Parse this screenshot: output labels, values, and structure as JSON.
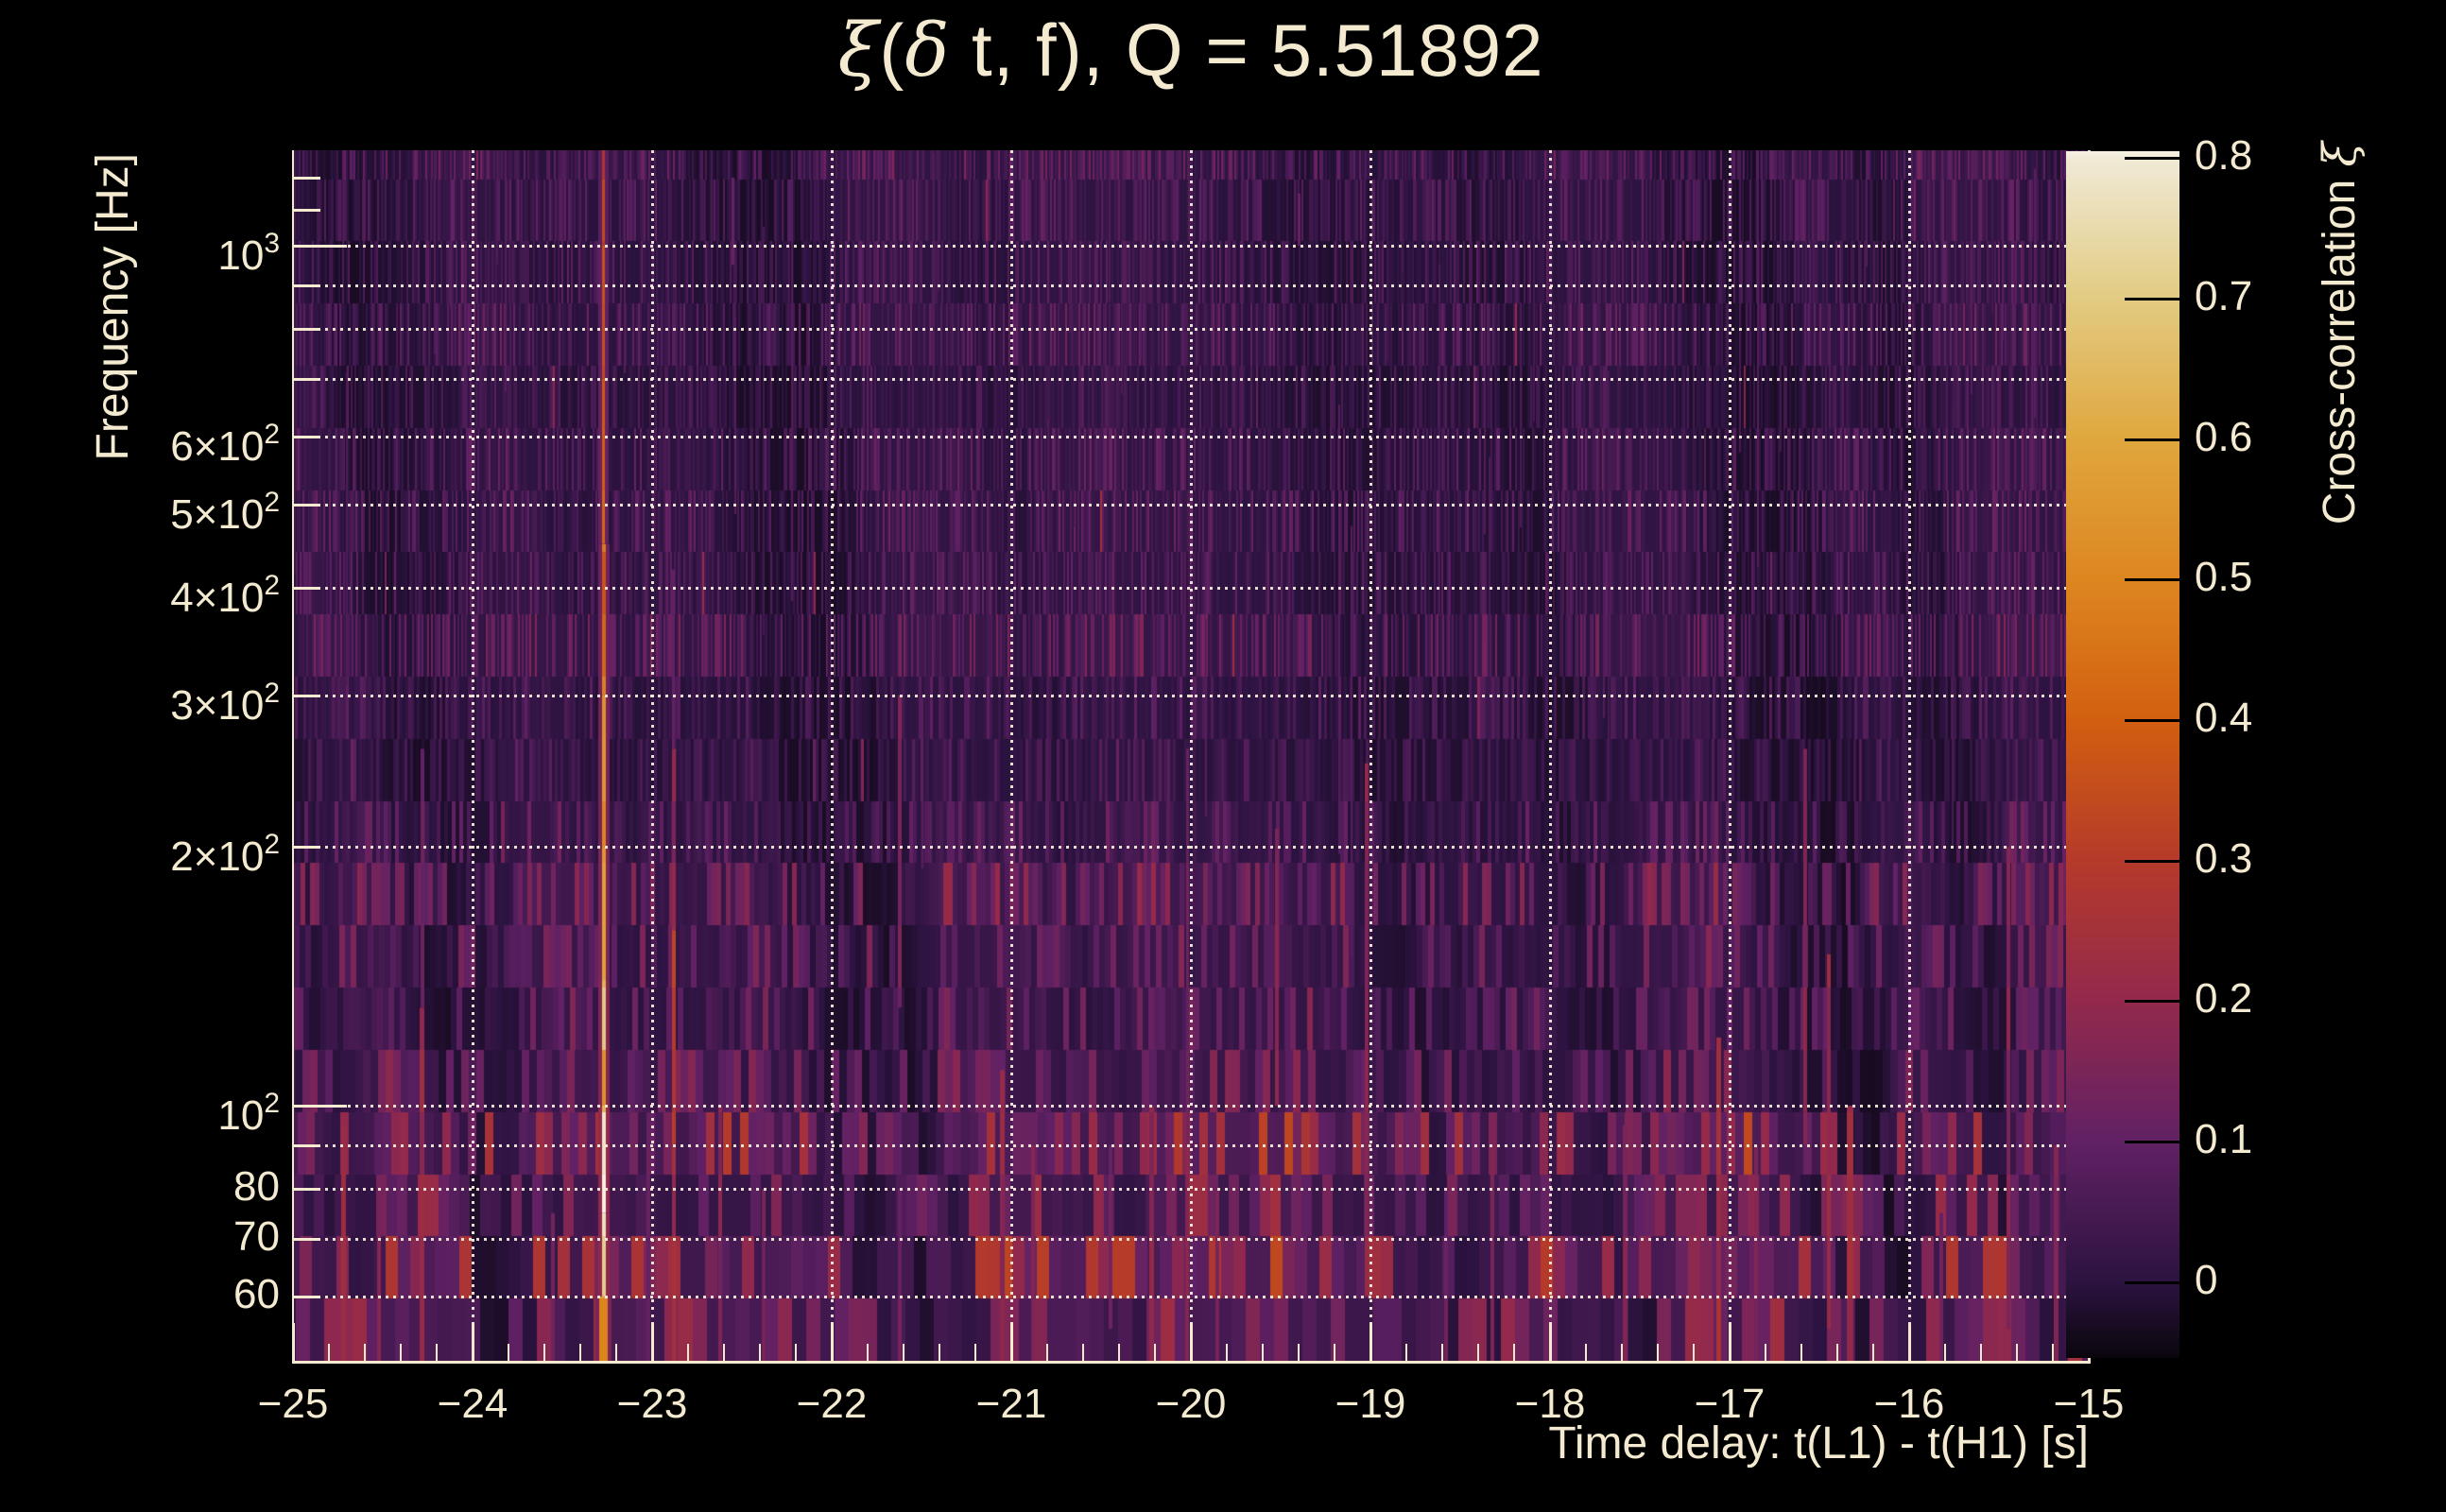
{
  "title": {
    "symbol_xi": "ξ",
    "open_paren": "(",
    "symbol_delta": "δ",
    "rest": " t, f), Q = 5.51892"
  },
  "axes": {
    "x": {
      "label": "Time delay: t(L1) - t(H1) [s]",
      "min": -25,
      "max": -15,
      "major_ticks": [
        {
          "value": -25,
          "label": "−25"
        },
        {
          "value": -24,
          "label": "−24"
        },
        {
          "value": -23,
          "label": "−23"
        },
        {
          "value": -22,
          "label": "−22"
        },
        {
          "value": -21,
          "label": "−21"
        },
        {
          "value": -20,
          "label": "−20"
        },
        {
          "value": -19,
          "label": "−19"
        },
        {
          "value": -18,
          "label": "−18"
        },
        {
          "value": -17,
          "label": "−17"
        },
        {
          "value": -16,
          "label": "−16"
        },
        {
          "value": -15,
          "label": "−15"
        }
      ],
      "minor_tick_step": 0.2
    },
    "y": {
      "label": "Frequency [Hz]",
      "scale": "log",
      "min_hz": 50.5,
      "max_hz": 1295,
      "tick_labels": [
        {
          "hz": 1000,
          "mantissa": "10",
          "exponent": "3"
        },
        {
          "hz": 600,
          "mantissa": "6×10",
          "exponent": "2"
        },
        {
          "hz": 500,
          "mantissa": "5×10",
          "exponent": "2"
        },
        {
          "hz": 400,
          "mantissa": "4×10",
          "exponent": "2"
        },
        {
          "hz": 300,
          "mantissa": "3×10",
          "exponent": "2"
        },
        {
          "hz": 200,
          "mantissa": "2×10",
          "exponent": "2"
        },
        {
          "hz": 100,
          "mantissa": "10",
          "exponent": "2"
        },
        {
          "hz": 80,
          "mantissa": "80",
          "exponent": ""
        },
        {
          "hz": 70,
          "mantissa": "70",
          "exponent": ""
        },
        {
          "hz": 60,
          "mantissa": "60",
          "exponent": ""
        }
      ],
      "gridline_hz": [
        60,
        70,
        80,
        90,
        100,
        200,
        300,
        400,
        500,
        600,
        700,
        800,
        900,
        1000
      ],
      "major_tick_hz": [
        100,
        1000
      ],
      "minor_tick_hz": [
        60,
        70,
        80,
        90,
        200,
        300,
        400,
        500,
        600,
        700,
        800,
        900,
        1100,
        1200
      ]
    }
  },
  "colorbar": {
    "label": "Cross-correlation ",
    "label_symbol": "ξ",
    "min": -0.054,
    "max": 0.805,
    "ticks": [
      {
        "value": 0.8,
        "label": "0.8"
      },
      {
        "value": 0.7,
        "label": "0.7"
      },
      {
        "value": 0.6,
        "label": "0.6"
      },
      {
        "value": 0.5,
        "label": "0.5"
      },
      {
        "value": 0.4,
        "label": "0.4"
      },
      {
        "value": 0.3,
        "label": "0.3"
      },
      {
        "value": 0.2,
        "label": "0.2"
      },
      {
        "value": 0.1,
        "label": "0.1"
      },
      {
        "value": 0.0,
        "label": "0"
      }
    ],
    "stops": [
      {
        "value": -0.054,
        "color": "#0a060c"
      },
      {
        "value": 0.0,
        "color": "#2c1340"
      },
      {
        "value": 0.1,
        "color": "#612164"
      },
      {
        "value": 0.2,
        "color": "#93294c"
      },
      {
        "value": 0.3,
        "color": "#b53a2a"
      },
      {
        "value": 0.4,
        "color": "#d25f10"
      },
      {
        "value": 0.5,
        "color": "#dd8620"
      },
      {
        "value": 0.6,
        "color": "#e0a73e"
      },
      {
        "value": 0.7,
        "color": "#e2cb82"
      },
      {
        "value": 0.8,
        "color": "#f0ead6"
      },
      {
        "value": 0.805,
        "color": "#f6f2e4"
      }
    ]
  },
  "chart_data": {
    "type": "heatmap",
    "title": "ξ(δ t, f), Q = 5.51892",
    "q_value": 5.51892,
    "xlabel": "Time delay: t(L1) - t(H1) [s]",
    "ylabel": "Frequency [Hz]",
    "xlim": [
      -25,
      -15
    ],
    "ylim_hz": [
      50.5,
      1295
    ],
    "y_scale": "log",
    "colorbar_label": "Cross-correlation ξ",
    "colorbar_range": [
      -0.054,
      0.805
    ],
    "grid": true,
    "legend_position": "right-colorbar",
    "background": {
      "mean_xi": 0.02,
      "description": "dark purple Q-transform tile noise, vertical stripes widening toward low frequency"
    },
    "band_ratio": 1.1812,
    "features": [
      {
        "t": -23.27,
        "peak_xi": 0.72,
        "segments": [
          [
            50,
            60,
            0.55,
            9
          ],
          [
            60,
            75,
            0.68,
            4
          ],
          [
            75,
            100,
            0.72,
            4
          ],
          [
            100,
            140,
            0.6,
            4
          ],
          [
            140,
            200,
            0.55,
            4
          ],
          [
            200,
            300,
            0.5,
            4
          ],
          [
            300,
            450,
            0.45,
            4
          ],
          [
            450,
            700,
            0.4,
            3
          ],
          [
            700,
            1000,
            0.35,
            3
          ],
          [
            1000,
            1295,
            0.3,
            3
          ]
        ]
      },
      {
        "t": -22.88,
        "peak_xi": 0.28,
        "segments": [
          [
            50,
            90,
            0.22,
            4
          ],
          [
            90,
            160,
            0.28,
            4
          ],
          [
            160,
            260,
            0.18,
            4
          ],
          [
            260,
            420,
            0.1,
            3
          ]
        ]
      },
      {
        "t": -24.72,
        "peak_xi": 0.2,
        "segments": [
          [
            50,
            95,
            0.2,
            5
          ]
        ]
      },
      {
        "t": -24.52,
        "peak_xi": 0.16,
        "segments": [
          [
            50,
            80,
            0.16,
            4
          ]
        ]
      },
      {
        "t": -24.28,
        "peak_xi": 0.2,
        "segments": [
          [
            50,
            130,
            0.2,
            5
          ],
          [
            130,
            260,
            0.12,
            4
          ]
        ]
      },
      {
        "t": -23.55,
        "peak_xi": 0.12,
        "segments": [
          [
            50,
            75,
            0.12,
            4
          ]
        ]
      },
      {
        "t": -23.02,
        "peak_xi": 0.12,
        "segments": [
          [
            50,
            90,
            0.12,
            4
          ]
        ]
      },
      {
        "t": -22.62,
        "peak_xi": 0.16,
        "segments": [
          [
            50,
            100,
            0.16,
            4
          ]
        ]
      },
      {
        "t": -22.38,
        "peak_xi": 0.13,
        "segments": [
          [
            50,
            80,
            0.13,
            4
          ]
        ]
      },
      {
        "t": -21.62,
        "peak_xi": 0.14,
        "segments": [
          [
            50,
            80,
            0.12,
            4
          ],
          [
            130,
            300,
            0.14,
            4
          ]
        ]
      },
      {
        "t": -21.05,
        "peak_xi": 0.2,
        "segments": [
          [
            50,
            110,
            0.2,
            5
          ]
        ]
      },
      {
        "t": -20.88,
        "peak_xi": 0.15,
        "segments": [
          [
            50,
            90,
            0.15,
            4
          ]
        ]
      },
      {
        "t": -20.45,
        "peak_xi": 0.12,
        "segments": [
          [
            55,
            90,
            0.12,
            4
          ]
        ]
      },
      {
        "t": -20.22,
        "peak_xi": 0.18,
        "segments": [
          [
            50,
            100,
            0.18,
            5
          ]
        ]
      },
      {
        "t": -20.02,
        "peak_xi": 0.16,
        "segments": [
          [
            50,
            90,
            0.16,
            4
          ],
          [
            90,
            260,
            0.12,
            3
          ]
        ]
      },
      {
        "t": -19.85,
        "peak_xi": 0.14,
        "segments": [
          [
            50,
            80,
            0.14,
            4
          ]
        ]
      },
      {
        "t": -19.52,
        "peak_xi": 0.16,
        "segments": [
          [
            100,
            210,
            0.16,
            4
          ]
        ]
      },
      {
        "t": -19.02,
        "peak_xi": 0.18,
        "segments": [
          [
            60,
            250,
            0.18,
            4
          ]
        ]
      },
      {
        "t": -18.58,
        "peak_xi": 0.12,
        "segments": [
          [
            50,
            80,
            0.12,
            4
          ]
        ]
      },
      {
        "t": -18.32,
        "peak_xi": 0.14,
        "segments": [
          [
            50,
            90,
            0.14,
            4
          ]
        ]
      },
      {
        "t": -17.58,
        "peak_xi": 0.16,
        "segments": [
          [
            50,
            95,
            0.16,
            5
          ]
        ]
      },
      {
        "t": -17.06,
        "peak_xi": 0.24,
        "segments": [
          [
            50,
            120,
            0.24,
            5
          ]
        ]
      },
      {
        "t": -16.85,
        "peak_xi": 0.16,
        "segments": [
          [
            50,
            90,
            0.16,
            4
          ]
        ]
      },
      {
        "t": -16.58,
        "peak_xi": 0.16,
        "segments": [
          [
            90,
            260,
            0.16,
            4
          ]
        ]
      },
      {
        "t": -16.45,
        "peak_xi": 0.2,
        "segments": [
          [
            55,
            150,
            0.2,
            4
          ]
        ]
      },
      {
        "t": -16.33,
        "peak_xi": 0.22,
        "segments": [
          [
            50,
            100,
            0.22,
            7
          ]
        ]
      },
      {
        "t": -15.82,
        "peak_xi": 0.12,
        "segments": [
          [
            50,
            75,
            0.12,
            4
          ]
        ]
      },
      {
        "t": -15.45,
        "peak_xi": 0.17,
        "segments": [
          [
            55,
            200,
            0.17,
            4
          ]
        ]
      },
      {
        "t": -15.18,
        "peak_xi": 0.16,
        "segments": [
          [
            50,
            90,
            0.16,
            5
          ]
        ]
      },
      {
        "t": -22.55,
        "peak_xi": 0.12,
        "segments": [
          [
            950,
            1200,
            0.12,
            3
          ]
        ]
      },
      {
        "t": -21.0,
        "peak_xi": 0.1,
        "segments": [
          [
            1150,
            1295,
            0.1,
            3
          ]
        ]
      },
      {
        "t": -19.4,
        "peak_xi": 0.1,
        "segments": [
          [
            1000,
            1150,
            0.1,
            3
          ]
        ]
      },
      {
        "t": -16.0,
        "peak_xi": 0.09,
        "segments": [
          [
            800,
            1000,
            0.09,
            3
          ]
        ]
      }
    ]
  },
  "style": {
    "text_color": "#f3ead0",
    "page_background": "#000000",
    "grid_color": "rgba(247,241,222,0.92)"
  }
}
